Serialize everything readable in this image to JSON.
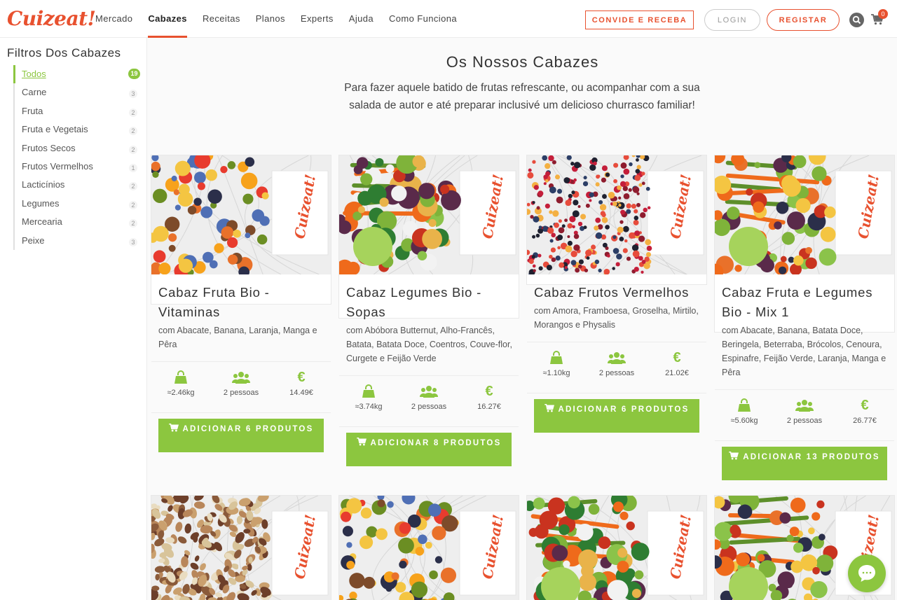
{
  "brand": {
    "logo_text": "Cuizeat!",
    "accent": "#e8512f",
    "green": "#8cc63f"
  },
  "header": {
    "nav": [
      "Mercado",
      "Cabazes",
      "Receitas",
      "Planos",
      "Experts",
      "Ajuda",
      "Como Funciona"
    ],
    "active_nav": "Cabazes",
    "invite_label": "CONVIDE E RECEBA",
    "login_label": "LOGIN",
    "register_label": "REGISTAR",
    "cart_count": "0"
  },
  "sidebar": {
    "title": "Filtros Dos Cabazes",
    "filters": [
      {
        "label": "Todos",
        "count": "19",
        "active": true
      },
      {
        "label": "Carne",
        "count": "3"
      },
      {
        "label": "Fruta",
        "count": "2"
      },
      {
        "label": "Fruta e Vegetais",
        "count": "2"
      },
      {
        "label": "Frutos Secos",
        "count": "2"
      },
      {
        "label": "Frutos Vermelhos",
        "count": "1"
      },
      {
        "label": "Lacticínios",
        "count": "2"
      },
      {
        "label": "Legumes",
        "count": "2"
      },
      {
        "label": "Mercearia",
        "count": "2"
      },
      {
        "label": "Peixe",
        "count": "3"
      }
    ]
  },
  "main": {
    "title": "Os Nossos Cabazes",
    "subtitle": "Para fazer aquele batido de frutas refrescante, ou acompanhar com a sua salada de autor e até preparar inclusivé um delicioso churrasco familiar!"
  },
  "cards": [
    {
      "title": "Cabaz Fruta Bio - Vitaminas",
      "desc": "com Abacate, Banana, Laranja, Manga e Pêra",
      "weight": "≈2.46kg",
      "people": "2 pessoas",
      "price": "14.49€",
      "button": "ADICIONAR 6 PRODUTOS",
      "image_type": "fruit"
    },
    {
      "title": "Cabaz Legumes Bio - Sopas",
      "desc": "com Abóbora Butternut, Alho-Francês, Batata, Batata Doce, Coentros, Couve-flor, Curgete e Feijão Verde",
      "weight": "≈3.74kg",
      "people": "2 pessoas",
      "price": "16.27€",
      "button": "ADICIONAR 8 PRODUTOS",
      "image_type": "veg"
    },
    {
      "title": "Cabaz Frutos Vermelhos",
      "desc": "com Amora, Framboesa, Groselha, Mirtilo, Morangos e Physalis",
      "weight": "≈1.10kg",
      "people": "2 pessoas",
      "price": "21.02€",
      "button": "ADICIONAR 6 PRODUTOS",
      "image_type": "berries"
    },
    {
      "title": "Cabaz Fruta e Legumes Bio - Mix 1",
      "desc": "com Abacate, Banana, Batata Doce, Beringela, Beterraba, Brócolos, Cenoura, Espinafre, Feijão Verde, Laranja, Manga e Pêra",
      "weight": "≈5.60kg",
      "people": "2 pessoas",
      "price": "26.77€",
      "button": "ADICIONAR 13 PRODUTOS",
      "image_type": "mix"
    }
  ],
  "bag_logo": "Cuizeat!",
  "second_row_images": [
    "nuts",
    "fruit",
    "veg",
    "mix"
  ]
}
